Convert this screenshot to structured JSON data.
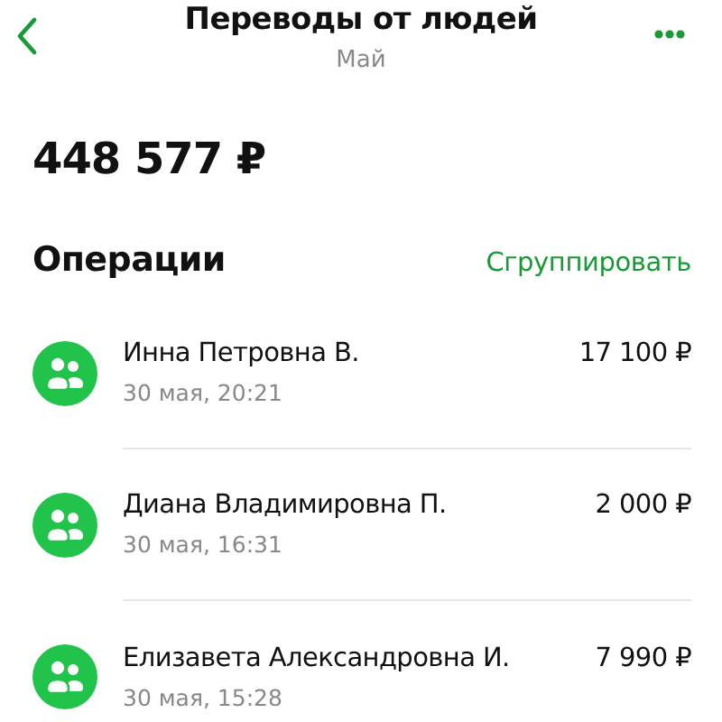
{
  "header": {
    "title": "Переводы от людей",
    "subtitle": "Май"
  },
  "total": "448 577 ₽",
  "section": {
    "title": "Операции",
    "action": "Сгруппировать"
  },
  "operations": [
    {
      "name": "Инна Петровна В.",
      "date": "30 мая, 20:21",
      "amount": "17 100 ₽"
    },
    {
      "name": "Диана Владимировна П.",
      "date": "30 мая, 16:31",
      "amount": "2 000 ₽"
    },
    {
      "name": "Елизавета Александровна И.",
      "date": "30 мая, 15:28",
      "amount": "7 990 ₽"
    }
  ]
}
